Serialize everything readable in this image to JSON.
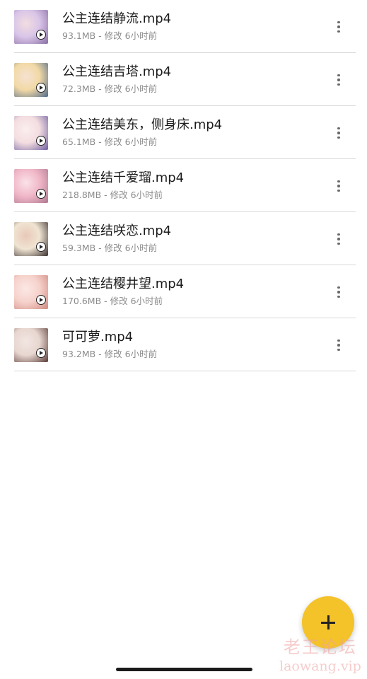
{
  "files": [
    {
      "name": "公主连结静流.mp4",
      "meta": "93.1MB - 修改 6小时前",
      "thumb_colors": [
        "#d9c5e8",
        "#8a6fa5",
        "#f2dde0"
      ]
    },
    {
      "name": "公主连结吉塔.mp4",
      "meta": "72.3MB - 修改 6小时前",
      "thumb_colors": [
        "#f2d9a6",
        "#4f6a8a",
        "#f5e2d2"
      ]
    },
    {
      "name": "公主连结美东，侧身床.mp4",
      "meta": "65.1MB - 修改 6小时前",
      "thumb_colors": [
        "#f3dde0",
        "#6e5fa0",
        "#fbeef0"
      ]
    },
    {
      "name": "公主连结千爱瑠.mp4",
      "meta": "218.8MB - 修改 6小时前",
      "thumb_colors": [
        "#f0b8c8",
        "#b07890",
        "#fae2ea"
      ]
    },
    {
      "name": "公主连结咲恋.mp4",
      "meta": "59.3MB - 修改 6小时前",
      "thumb_colors": [
        "#f0e4d2",
        "#3a3030",
        "#e8c8b8"
      ]
    },
    {
      "name": "公主连结樱井望.mp4",
      "meta": "170.6MB - 修改 6小时前",
      "thumb_colors": [
        "#f6d2cc",
        "#d08a80",
        "#fbe8e4"
      ]
    },
    {
      "name": "可可萝.mp4",
      "meta": "93.2MB - 修改 6小时前",
      "thumb_colors": [
        "#e8d6d0",
        "#5a3c38",
        "#f2e6e2"
      ]
    }
  ],
  "fab": {
    "icon": "plus-icon",
    "color": "#f4c229"
  },
  "watermark": {
    "line1": "老王论坛",
    "line2": "laowang.vip"
  }
}
